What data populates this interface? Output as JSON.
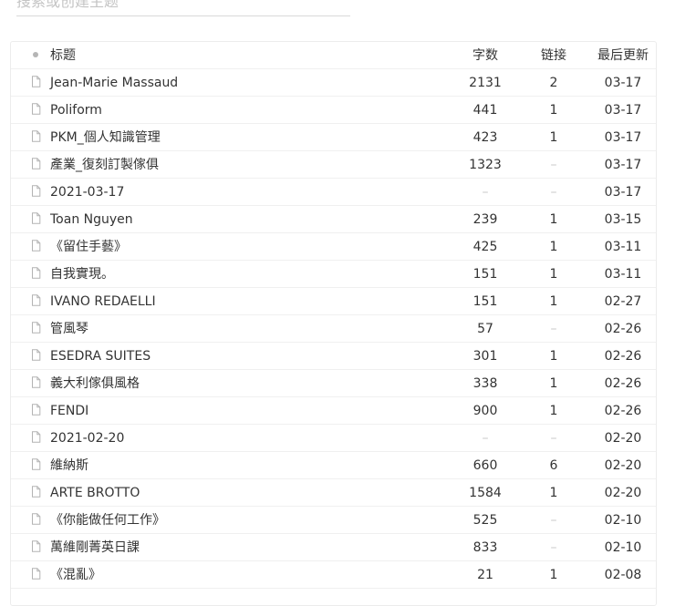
{
  "search": {
    "placeholder": "搜索或创建主题"
  },
  "table": {
    "headers": {
      "title": "标题",
      "words": "字数",
      "links": "链接",
      "updated": "最后更新"
    },
    "rows": [
      {
        "title": "Jean-Marie Massaud",
        "words": "2131",
        "links": "2",
        "updated": "03-17"
      },
      {
        "title": "Poliform",
        "words": "441",
        "links": "1",
        "updated": "03-17"
      },
      {
        "title": "PKM_個人知識管理",
        "words": "423",
        "links": "1",
        "updated": "03-17"
      },
      {
        "title": "產業_復刻訂製傢俱",
        "words": "1323",
        "links": "–",
        "updated": "03-17"
      },
      {
        "title": "2021-03-17",
        "words": "–",
        "links": "–",
        "updated": "03-17"
      },
      {
        "title": "Toan Nguyen",
        "words": "239",
        "links": "1",
        "updated": "03-15"
      },
      {
        "title": "《留住手藝》",
        "words": "425",
        "links": "1",
        "updated": "03-11"
      },
      {
        "title": "自我實現。",
        "words": "151",
        "links": "1",
        "updated": "03-11"
      },
      {
        "title": "IVANO REDAELLI",
        "words": "151",
        "links": "1",
        "updated": "02-27"
      },
      {
        "title": "管風琴",
        "words": "57",
        "links": "–",
        "updated": "02-26"
      },
      {
        "title": "ESEDRA SUITES",
        "words": "301",
        "links": "1",
        "updated": "02-26"
      },
      {
        "title": "義大利傢俱風格",
        "words": "338",
        "links": "1",
        "updated": "02-26"
      },
      {
        "title": "FENDI",
        "words": "900",
        "links": "1",
        "updated": "02-26"
      },
      {
        "title": "2021-02-20",
        "words": "–",
        "links": "–",
        "updated": "02-20"
      },
      {
        "title": "維納斯",
        "words": "660",
        "links": "6",
        "updated": "02-20"
      },
      {
        "title": "ARTE BROTTO",
        "words": "1584",
        "links": "1",
        "updated": "02-20"
      },
      {
        "title": "《你能做任何工作》",
        "words": "525",
        "links": "–",
        "updated": "02-10"
      },
      {
        "title": "萬維剛菁英日課",
        "words": "833",
        "links": "–",
        "updated": "02-10"
      },
      {
        "title": "《混亂》",
        "words": "21",
        "links": "1",
        "updated": "02-08"
      }
    ]
  }
}
